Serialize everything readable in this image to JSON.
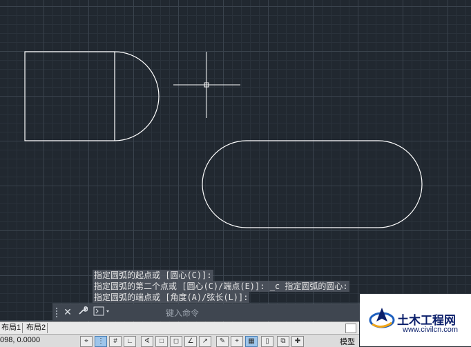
{
  "command_history": [
    "指定圆弧的起点或 [圆心(C)]:",
    "指定圆弧的第二个点或 [圆心(C)/端点(E)]: _c 指定圆弧的圆心:",
    "指定圆弧的端点或 [角度(A)/弦长(L)]:"
  ],
  "command_line": {
    "placeholder": "键入命令",
    "close_icon": "close-icon",
    "settings_icon": "wrench-icon",
    "prompt_icon": "command-prompt-icon"
  },
  "layout_tabs": [
    "布局1",
    "布局2"
  ],
  "status_bar": {
    "coordinates": "098, 0.0000",
    "model_label": "模型"
  },
  "watermark": {
    "title": "土木工程网",
    "url": "www.civilcn.com"
  },
  "colors": {
    "canvas_background": "#212830",
    "geometry_stroke": "#ffffff",
    "watermark_blue": "#0b1f6b"
  }
}
